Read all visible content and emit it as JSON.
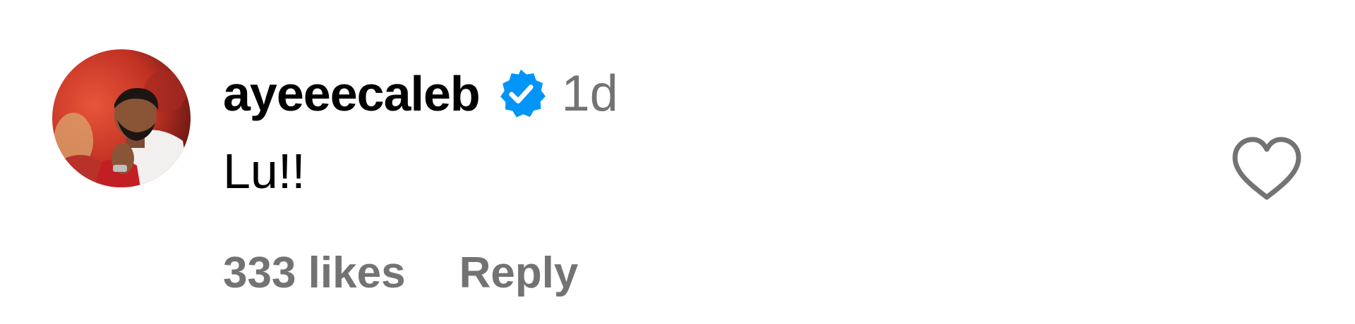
{
  "comment": {
    "username": "ayeeecaleb",
    "verified_icon": "verified-badge-icon",
    "timestamp": "1d",
    "text": "Lu!!",
    "likes": "333 likes",
    "reply_label": "Reply",
    "like_icon": "heart-outline-icon"
  },
  "colors": {
    "verified_blue": "#0095f6",
    "secondary_text": "#737373",
    "heart_stroke": "#737373"
  }
}
